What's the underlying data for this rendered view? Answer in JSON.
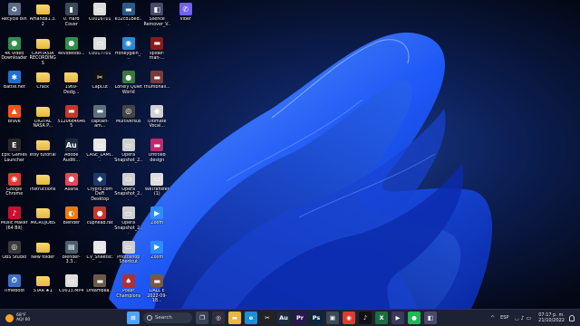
{
  "desktop_icons": [
    {
      "label": "Recycle Bin",
      "icon": "recycle-bin-icon",
      "glyph": "♻",
      "color": "#5a6a88",
      "type": "app"
    },
    {
      "label": "4K Video Downloader",
      "icon": "4k-video-downloader-icon",
      "glyph": "●",
      "color": "#2f8f4a",
      "type": "app"
    },
    {
      "label": "Battle.net",
      "icon": "battle-net-icon",
      "glyph": "✱",
      "color": "#1f6fd6",
      "type": "app"
    },
    {
      "label": "Brave",
      "icon": "brave-icon",
      "glyph": "▲",
      "color": "#f0531c",
      "type": "app"
    },
    {
      "label": "Epic Games Launcher",
      "icon": "epic-games-icon",
      "glyph": "E",
      "color": "#2a2a2a",
      "type": "app"
    },
    {
      "label": "Google Chrome",
      "icon": "chrome-icon",
      "glyph": "◉",
      "color": "#de3b2f",
      "type": "app"
    },
    {
      "label": "Music Maker (64 Bit)",
      "icon": "music-maker-icon",
      "glyph": "♪",
      "color": "#c8102e",
      "type": "app"
    },
    {
      "label": "OBS Studio",
      "icon": "obs-studio-icon",
      "glyph": "◎",
      "color": "#3a3a3a",
      "type": "app"
    },
    {
      "label": "TimeBoot",
      "icon": "timeboot-icon",
      "glyph": "⏱",
      "color": "#3c6fc4",
      "type": "app"
    },
    {
      "label": "Amanda1.3.2",
      "icon": "folder-icon",
      "type": "folder"
    },
    {
      "label": "CAMTASIA RECORDINGS",
      "icon": "folder-icon",
      "type": "folder"
    },
    {
      "label": "Crack",
      "icon": "folder-icon",
      "type": "folder"
    },
    {
      "label": "DIGITAL NASA P...",
      "icon": "folder-icon",
      "type": "folder"
    },
    {
      "label": "etsy tutorial",
      "icon": "folder-icon",
      "type": "folder"
    },
    {
      "label": "Instructions",
      "icon": "folder-icon",
      "type": "folder"
    },
    {
      "label": "MICROJOBS",
      "icon": "folder-icon",
      "type": "folder"
    },
    {
      "label": "New folder",
      "icon": "folder-icon",
      "type": "folder"
    },
    {
      "label": "STAR ★1",
      "icon": "folder-icon",
      "type": "folder"
    },
    {
      "label": "0. Hard Cover",
      "icon": "image-file-icon",
      "glyph": "▮",
      "color": "#3a4a5a",
      "type": "app"
    },
    {
      "label": "4kvideodo...",
      "icon": "4k-video-downloader-icon",
      "glyph": "●",
      "color": "#2f8f4a",
      "type": "app"
    },
    {
      "label": "1969-Dodg...",
      "icon": "folder-icon",
      "type": "folder"
    },
    {
      "label": "51206846465",
      "icon": "image-file-icon",
      "glyph": "▬",
      "color": "#c0392b",
      "type": "app"
    },
    {
      "label": "Adobe Auditi...",
      "icon": "adobe-audition-icon",
      "glyph": "Au",
      "color": "#1c2b3e",
      "type": "app"
    },
    {
      "label": "Asana",
      "icon": "asana-icon",
      "glyph": "●",
      "color": "#e8455b",
      "type": "app"
    },
    {
      "label": "Blender",
      "icon": "blender-icon",
      "glyph": "◐",
      "color": "#e87d0d",
      "type": "app"
    },
    {
      "label": "blender-3.3...",
      "icon": "zip-file-icon",
      "glyph": "▤",
      "color": "#4a6070",
      "type": "app"
    },
    {
      "label": "C0013.MP4",
      "icon": "video-file-icon",
      "glyph": "▭",
      "color": "#dddddd",
      "type": "app"
    },
    {
      "label": "C0016T01",
      "icon": "video-file-icon",
      "glyph": "▭",
      "color": "#dddddd",
      "type": "app"
    },
    {
      "label": "C0017T01",
      "icon": "video-file-icon",
      "glyph": "▭",
      "color": "#dddddd",
      "type": "app"
    },
    {
      "label": "CapCut",
      "icon": "capcut-icon",
      "glyph": "✂",
      "color": "#111111",
      "type": "app"
    },
    {
      "label": "captain-am...",
      "icon": "image-file-icon",
      "glyph": "▬",
      "color": "#5c6f7e",
      "type": "app"
    },
    {
      "label": "CASE_LAMI...",
      "icon": "document-file-icon",
      "glyph": "▭",
      "color": "#e6e6e6",
      "type": "app"
    },
    {
      "label": "Crypto.com DeFi Desktop",
      "icon": "crypto-com-icon",
      "glyph": "◆",
      "color": "#1a3a6a",
      "type": "app"
    },
    {
      "label": "cuphead.fat",
      "icon": "cuphead-icon",
      "glyph": "●",
      "color": "#c0392b",
      "type": "app"
    },
    {
      "label": "CV_Sheetsc...",
      "icon": "document-file-icon",
      "glyph": "▭",
      "color": "#e6e6e6",
      "type": "app"
    },
    {
      "label": "Dreambea...",
      "icon": "image-file-icon",
      "glyph": "▬",
      "color": "#6a5a4a",
      "type": "app"
    },
    {
      "label": "e32cd1bed...",
      "icon": "image-file-icon",
      "glyph": "▬",
      "color": "#2a5a8a",
      "type": "app"
    },
    {
      "label": "Honeygain_...",
      "icon": "honeygain-icon",
      "glyph": "◉",
      "color": "#2a8ad6",
      "type": "app"
    },
    {
      "label": "Lonely Quiet World",
      "icon": "image-file-icon",
      "glyph": "●",
      "color": "#3a7a3a",
      "type": "app"
    },
    {
      "label": "MultiVersus",
      "icon": "multiversus-icon",
      "glyph": "◎",
      "color": "#444444",
      "type": "app"
    },
    {
      "label": "Opera Snapshot_2...",
      "icon": "image-file-icon",
      "glyph": "▭",
      "color": "#cfcfcf",
      "type": "app"
    },
    {
      "label": "Opera Snapshot_2...",
      "icon": "image-file-icon",
      "glyph": "▭",
      "color": "#cfcfcf",
      "type": "app"
    },
    {
      "label": "Opera Snapshot_2...",
      "icon": "image-file-icon",
      "glyph": "▭",
      "color": "#cfcfcf",
      "type": "app"
    },
    {
      "label": "Photoshop Shortcut",
      "icon": "image-file-icon",
      "glyph": "▭",
      "color": "#cfcfcf",
      "type": "app"
    },
    {
      "label": "Poker Champions",
      "icon": "poker-icon",
      "glyph": "♠",
      "color": "#b03030",
      "type": "app"
    },
    {
      "label": "Silence Remover_V...",
      "icon": "silence-remover-icon",
      "glyph": "◧",
      "color": "#4a4a6a",
      "type": "app"
    },
    {
      "label": "spider-man-...",
      "icon": "image-file-icon",
      "glyph": "▬",
      "color": "#8a1a1a",
      "type": "app"
    },
    {
      "label": "thumbnail...",
      "icon": "image-file-icon",
      "glyph": "▬",
      "color": "#7a3a3a",
      "type": "app"
    },
    {
      "label": "Ultimate Vocal...",
      "icon": "ultimate-vocal-icon",
      "glyph": "◉",
      "color": "#d0d0d0",
      "type": "app"
    },
    {
      "label": "Untitled design",
      "icon": "image-file-icon",
      "glyph": "▬",
      "color": "#c02a6a",
      "type": "app"
    },
    {
      "label": "WeTransfer (1)",
      "icon": "wetransfer-icon",
      "glyph": "▭",
      "color": "#dedede",
      "type": "app"
    },
    {
      "label": "Zoom",
      "icon": "zoom-icon",
      "glyph": "▶",
      "color": "#2d8cff",
      "type": "app"
    },
    {
      "label": "Zoom",
      "icon": "zoom-icon",
      "glyph": "▶",
      "color": "#2d8cff",
      "type": "app"
    },
    {
      "label": "DALL E 2022-09-18...",
      "icon": "image-file-icon",
      "glyph": "▬",
      "color": "#7a5a3a",
      "type": "app"
    },
    {
      "label": "Viber",
      "icon": "viber-icon",
      "glyph": "✆",
      "color": "#7360f2",
      "type": "app"
    }
  ],
  "taskbar": {
    "weather": {
      "temp": "68°F",
      "aqi": "AQI 60"
    },
    "search_placeholder": "Search",
    "apps": [
      {
        "name": "start-button",
        "glyph": "⊞",
        "color": "#4fa3ff"
      },
      {
        "name": "task-view-icon",
        "glyph": "❐",
        "color": "#3a4258"
      },
      {
        "name": "obs-taskbar-icon",
        "glyph": "◎",
        "color": "#2f2f3f"
      },
      {
        "name": "file-explorer-icon",
        "glyph": "▬",
        "color": "#e8b83c"
      },
      {
        "name": "edge-icon",
        "glyph": "e",
        "color": "#1e8fd6"
      },
      {
        "name": "capcut-taskbar-icon",
        "glyph": "✂",
        "color": "#222222"
      },
      {
        "name": "audition-icon",
        "glyph": "Au",
        "color": "#1c2b3e"
      },
      {
        "name": "premiere-icon",
        "glyph": "Pr",
        "color": "#2a1650"
      },
      {
        "name": "photoshop-icon",
        "glyph": "Ps",
        "color": "#0b2540"
      },
      {
        "name": "screen-recorder-icon",
        "glyph": "▣",
        "color": "#3a4a5a"
      },
      {
        "name": "chrome-taskbar-icon",
        "glyph": "◉",
        "color": "#de3b2f"
      },
      {
        "name": "tiktok-icon",
        "glyph": "♪",
        "color": "#111111"
      },
      {
        "name": "excel-icon",
        "glyph": "X",
        "color": "#1d6f42"
      },
      {
        "name": "media-player-icon",
        "glyph": "▶",
        "color": "#3a3a5a"
      },
      {
        "name": "spotify-icon",
        "glyph": "●",
        "color": "#1db954"
      },
      {
        "name": "misc-app-icon",
        "glyph": "◧",
        "color": "#4a4a6a"
      }
    ],
    "tray": {
      "language": "ESP",
      "time": "07:17 p. m.",
      "date": "21/10/2022"
    }
  }
}
